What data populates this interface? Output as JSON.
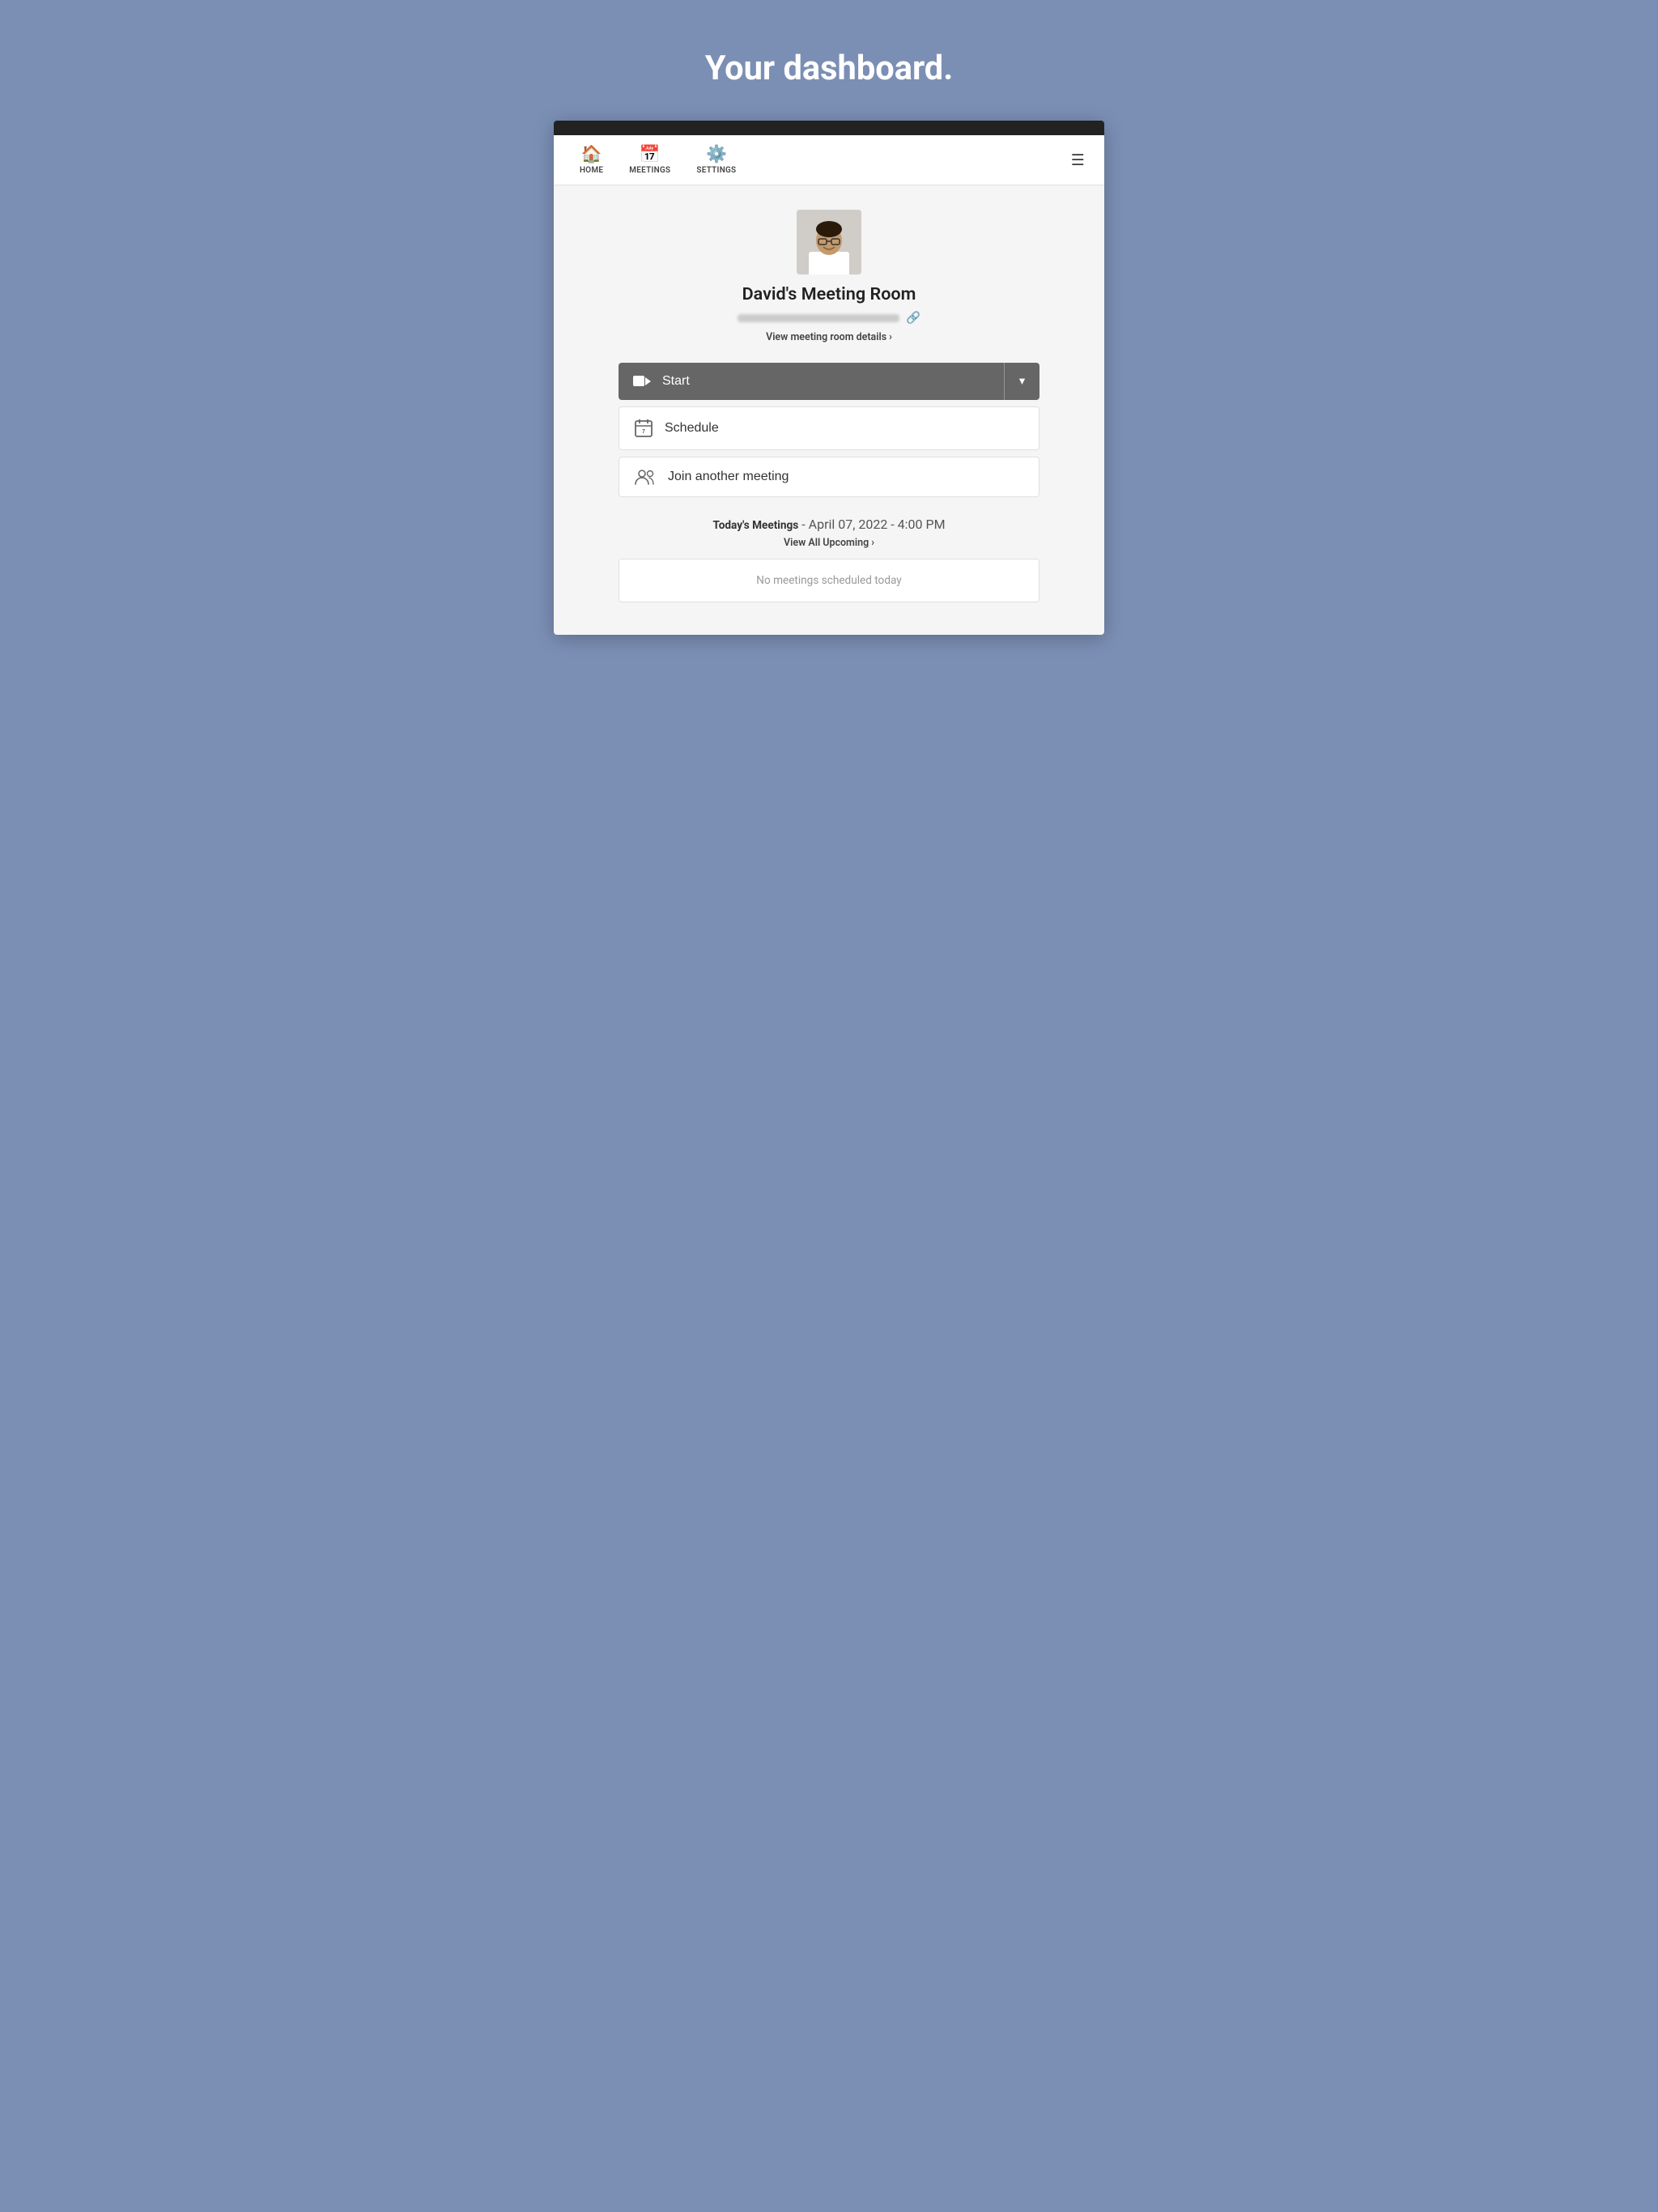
{
  "page": {
    "title": "Your dashboard.",
    "background_color": "#7b8fb5"
  },
  "nav": {
    "home_label": "HOME",
    "meetings_label": "MEETINGS",
    "settings_label": "SETTINGS"
  },
  "profile": {
    "room_name": "David's Meeting Room",
    "view_details_label": "View meeting room details",
    "view_details_chevron": "›"
  },
  "actions": {
    "start_label": "Start",
    "schedule_label": "Schedule",
    "join_label": "Join another meeting"
  },
  "meetings": {
    "section_title": "Today's Meetings",
    "date_label": "- April 07, 2022 - 4:00 PM",
    "view_all_label": "View All Upcoming",
    "view_all_chevron": "›",
    "no_meetings_label": "No meetings scheduled today"
  }
}
